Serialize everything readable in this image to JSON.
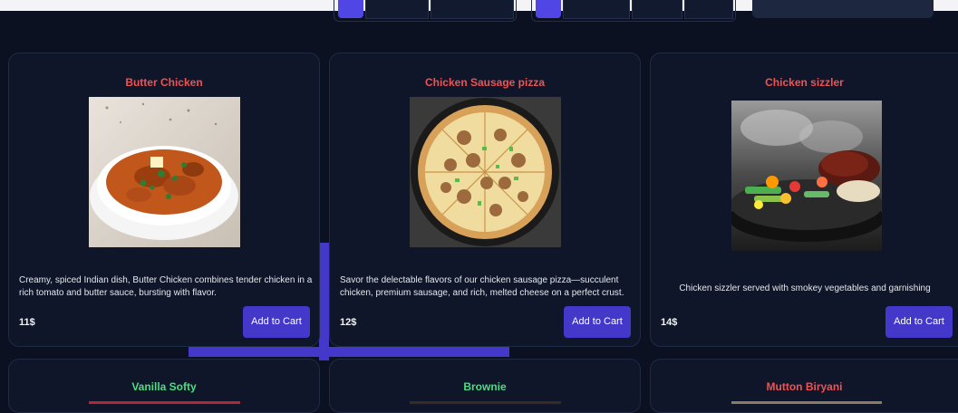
{
  "products": [
    {
      "name": "Butter Chicken",
      "description": "Creamy, spiced Indian dish, Butter Chicken combines tender chicken in a rich tomato and butter sauce, bursting with flavor.",
      "price": "11$",
      "button": "Add to Cart",
      "image_icon": "curry-bowl-image"
    },
    {
      "name": "Chicken Sausage pizza",
      "description": "Savor the delectable flavors of our chicken sausage pizza—succulent chicken, premium sausage, and rich, melted cheese on a perfect crust.",
      "price": "12$",
      "button": "Add to Cart",
      "image_icon": "pizza-image"
    },
    {
      "name": "Chicken sizzler",
      "description": "Chicken sizzler served with smokey vegetables and garnishing",
      "price": "14$",
      "button": "Add to Cart",
      "image_icon": "sizzler-plate-image"
    }
  ],
  "next_row": [
    {
      "name": "Vanilla Softy",
      "title_color": "#4ade80"
    },
    {
      "name": "Brownie",
      "title_color": "#4ade80"
    },
    {
      "name": "Mutton Biryani",
      "title_color": "#f05252"
    }
  ],
  "colors": {
    "background": "#0b1120",
    "card": "#0f1629",
    "accent": "#4338ca",
    "title_red": "#f05252",
    "title_green": "#4ade80"
  }
}
